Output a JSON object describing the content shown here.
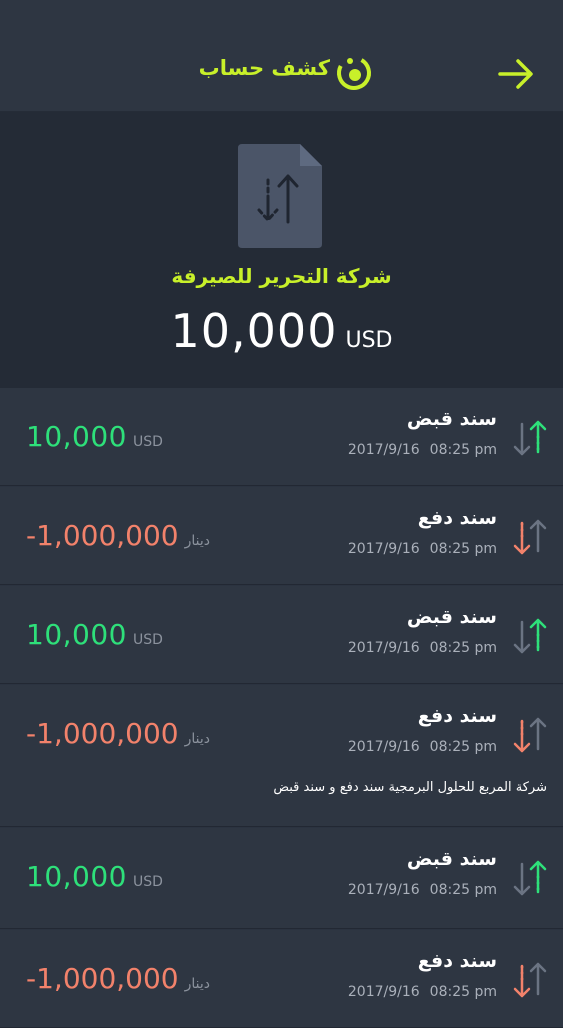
{
  "header": {
    "title": "كشف حساب",
    "accent": "#c8f02a"
  },
  "summary": {
    "company": "شركة التحرير للصيرفة",
    "amount": "10,000",
    "currency": "USD"
  },
  "transactions": [
    {
      "title": "سند قبض",
      "date": "2017/9/16",
      "time": "08:25 pm",
      "amount": "10,000",
      "currency": "USD",
      "direction": "in"
    },
    {
      "title": "سند دفع",
      "date": "2017/9/16",
      "time": "08:25 pm",
      "amount": "-1,000,000",
      "currency": "دينار",
      "direction": "out"
    },
    {
      "title": "سند قبض",
      "date": "2017/9/16",
      "time": "08:25 pm",
      "amount": "10,000",
      "currency": "USD",
      "direction": "in"
    },
    {
      "title": "سند دفع",
      "date": "2017/9/16",
      "time": "08:25 pm",
      "amount": "-1,000,000",
      "currency": "دينار",
      "direction": "out",
      "note": "شركة المربع للحلول البرمجية سند دفع و سند قبض"
    },
    {
      "title": "سند قبض",
      "date": "2017/9/16",
      "time": "08:25 pm",
      "amount": "10,000",
      "currency": "USD",
      "direction": "in"
    },
    {
      "title": "سند دفع",
      "date": "2017/9/16",
      "time": "08:25 pm",
      "amount": "-1,000,000",
      "currency": "دينار",
      "direction": "out"
    }
  ],
  "colors": {
    "positive": "#2ee07a",
    "negative": "#f2826b",
    "background": "#2b3340"
  }
}
